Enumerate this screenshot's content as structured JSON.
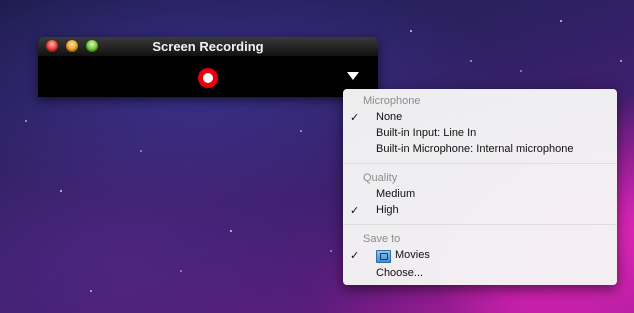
{
  "window": {
    "title": "Screen Recording"
  },
  "menu": {
    "sections": [
      {
        "header": "Microphone",
        "items": [
          {
            "label": "None",
            "checked": true
          },
          {
            "label": "Built-in Input: Line In",
            "checked": false
          },
          {
            "label": "Built-in Microphone: Internal microphone",
            "checked": false
          }
        ]
      },
      {
        "header": "Quality",
        "items": [
          {
            "label": "Medium",
            "checked": false
          },
          {
            "label": "High",
            "checked": true
          }
        ]
      },
      {
        "header": "Save to",
        "items": [
          {
            "label": "Movies",
            "checked": true,
            "icon": "folder-icon"
          },
          {
            "label": "Choose...",
            "checked": false
          }
        ]
      }
    ],
    "check_mark": "✓"
  },
  "colors": {
    "record_red": "#e8000c",
    "menu_header_gray": "#8c8c8c"
  }
}
